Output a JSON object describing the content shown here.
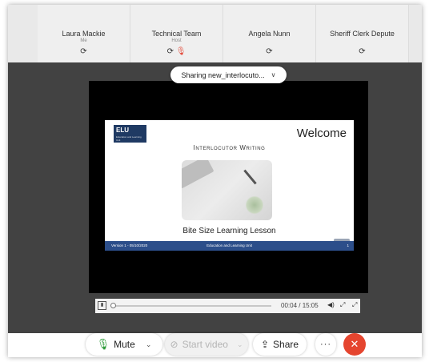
{
  "participants": [
    {
      "name": "Laura Mackie",
      "role": "Me",
      "icon": "sync-icon",
      "glyph": "⟳",
      "extra_glyph": ""
    },
    {
      "name": "Technical Team",
      "role": "Host",
      "icon": "sync-icon",
      "glyph": "⟳",
      "extra_glyph": "🎙"
    },
    {
      "name": "Angela Nunn",
      "role": "",
      "icon": "sync-icon",
      "glyph": "⟳",
      "extra_glyph": ""
    },
    {
      "name": "Sheriff Clerk Depute",
      "role": "",
      "icon": "sync-icon",
      "glyph": "⟳",
      "extra_glyph": ""
    }
  ],
  "sharing": {
    "label": "Sharing new_interlocuto...",
    "chevron": "∨"
  },
  "slide": {
    "logo": "ELU",
    "logo_sub": "Education and Learning Unit",
    "title": "Welcome",
    "subtitle": "Interlocutor Writing",
    "lesson": "Bite Size Learning Lesson",
    "footer_left": "Version 1 - 05/10/2020",
    "footer_center": "Education and Learning Unit",
    "footer_right": "1"
  },
  "media": {
    "play_glyph": "▮",
    "time": "00:04 / 15:05",
    "progress": 0.004,
    "volume_glyph": "◀)",
    "fullscreen_glyph": "⤢",
    "expand_glyph": "⤢"
  },
  "toolbar": {
    "mute_label": "Mute",
    "mic_glyph": "🎙",
    "chevron": "⌄",
    "video_label": "Start video",
    "video_glyph": "⊘",
    "share_label": "Share",
    "share_glyph": "⇪",
    "more_glyph": "···",
    "end_glyph": "✕"
  },
  "colors": {
    "end_call": "#e5452f",
    "mic_active": "#2e9b3a",
    "slide_footer": "#2c4e8a",
    "muted_red": "#e34a3a"
  }
}
